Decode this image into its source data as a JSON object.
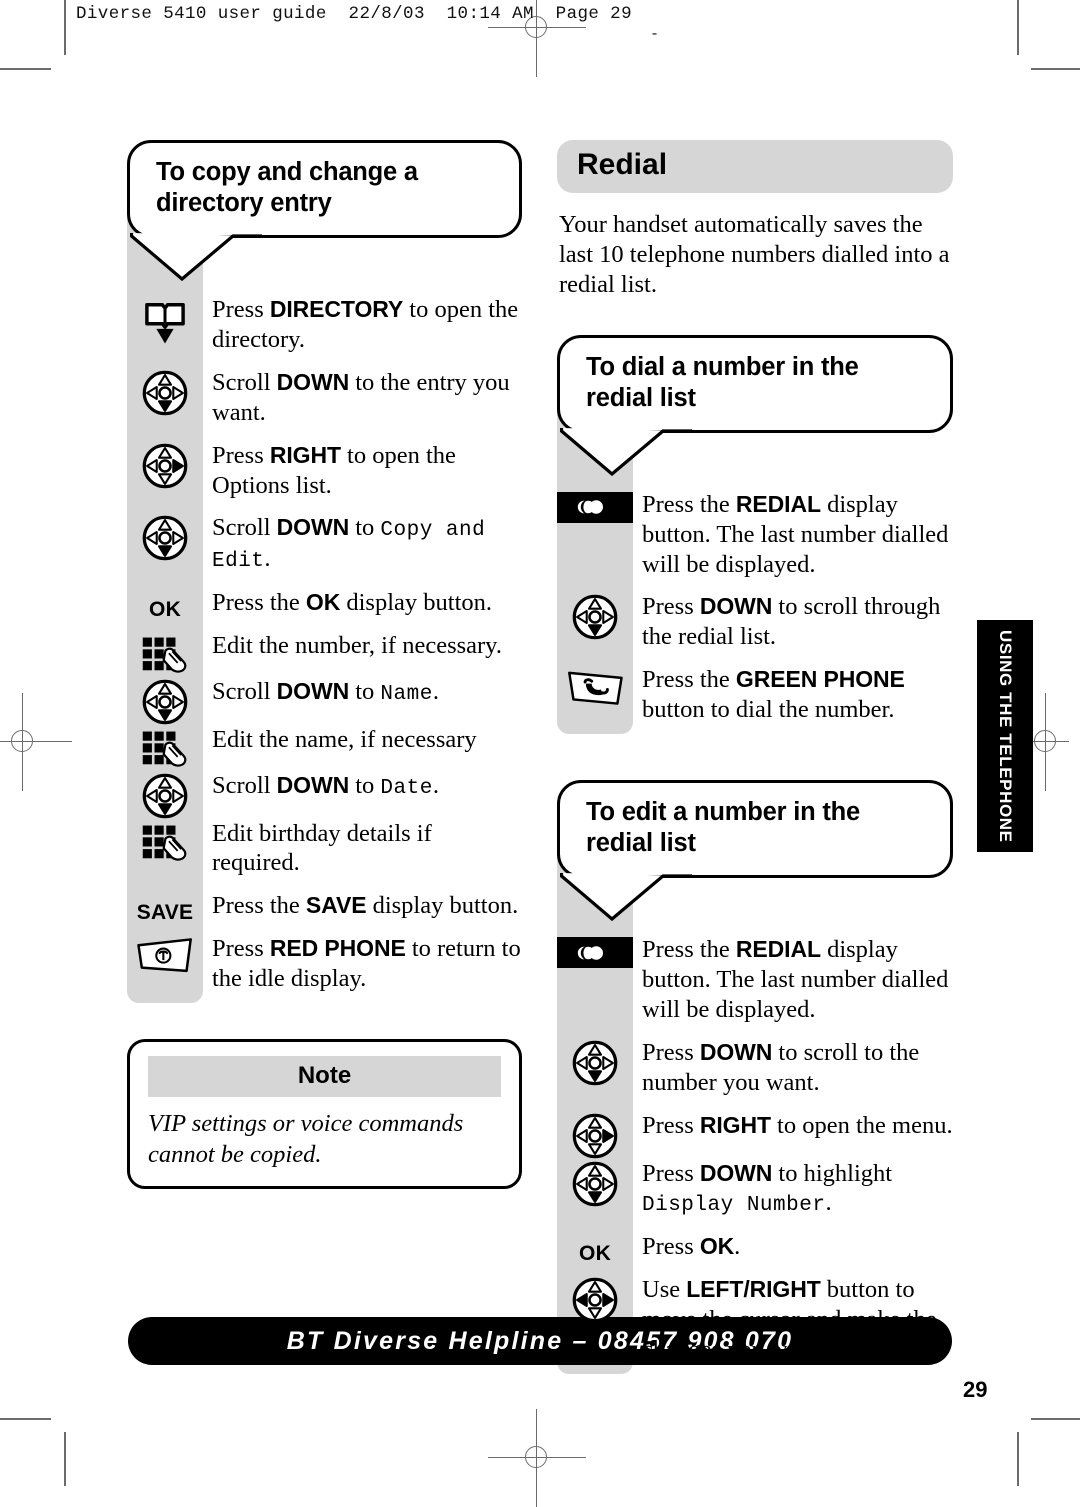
{
  "printer_slug": "Diverse 5410 user guide  22/8/03  10:14 AM  Page 29",
  "slug_dash": "-",
  "left_column": {
    "callout": {
      "title_line1": "To copy and change a",
      "title_line2": "directory entry"
    },
    "steps": [
      {
        "icon": "directory-book-icon",
        "icon_label": "",
        "text_html": "Press <b>DIRECTORY</b> to open the directory."
      },
      {
        "icon": "navpad-down-icon",
        "icon_label": "",
        "text_html": "Scroll <b>DOWN</b> to the entry you want."
      },
      {
        "icon": "navpad-right-icon",
        "icon_label": "",
        "text_html": "Press <b>RIGHT</b> to open the Options list."
      },
      {
        "icon": "navpad-down-icon",
        "icon_label": "",
        "text_html": "Scroll <b>DOWN</b> to <span class=\"lcd\">Copy and Edit</span>."
      },
      {
        "icon": "display-button-label",
        "icon_label": "OK",
        "text_html": "Press the <b>OK</b> display button."
      },
      {
        "icon": "keypad-hand-icon",
        "icon_label": "",
        "text_html": "Edit the number, if necessary."
      },
      {
        "icon": "navpad-down-icon",
        "icon_label": "",
        "text_html": "Scroll <b>DOWN</b> to <span class=\"lcd\">Name</span>."
      },
      {
        "icon": "keypad-hand-icon",
        "icon_label": "",
        "text_html": "Edit the name, if necessary"
      },
      {
        "icon": "navpad-down-icon",
        "icon_label": "",
        "text_html": "Scroll <b>DOWN</b> to <span class=\"lcd\">Date</span>."
      },
      {
        "icon": "keypad-hand-icon",
        "icon_label": "",
        "text_html": "Edit birthday details if required."
      },
      {
        "icon": "display-button-label",
        "icon_label": "SAVE",
        "text_html": "Press the <b>SAVE</b> display button."
      },
      {
        "icon": "red-phone-icon",
        "icon_label": "",
        "text_html": "Press <b>RED PHONE</b> to return to the idle display."
      }
    ],
    "note": {
      "heading": "Note",
      "body": "VIP settings or voice commands cannot be copied."
    }
  },
  "right_column": {
    "section_heading": "Redial",
    "intro": "Your handset automatically saves the last 10 telephone numbers dialled into a redial list.",
    "callout_dial": {
      "title_line1": "To dial a number in the",
      "title_line2": "redial list"
    },
    "steps_dial": [
      {
        "icon": "redial-display-button-icon",
        "icon_label": "",
        "text_html": "Press the <b>REDIAL</b> display button. The last number dialled will be displayed."
      },
      {
        "icon": "navpad-down-icon",
        "icon_label": "",
        "text_html": "Press <b>DOWN</b> to scroll through the redial list."
      },
      {
        "icon": "green-phone-icon",
        "icon_label": "",
        "text_html": "Press the <b>GREEN PHONE</b> button to dial the number."
      }
    ],
    "callout_edit": {
      "title_line1": "To edit a number in the",
      "title_line2": "redial list"
    },
    "steps_edit": [
      {
        "icon": "redial-display-button-icon",
        "icon_label": "",
        "text_html": "Press the <b>REDIAL</b> display button. The last number dialled will be displayed."
      },
      {
        "icon": "navpad-down-icon",
        "icon_label": "",
        "text_html": "Press <b>DOWN</b> to scroll to the number you want."
      },
      {
        "icon": "navpad-right-icon",
        "icon_label": "",
        "text_html": "Press <b>RIGHT</b> to open the menu."
      },
      {
        "icon": "navpad-down-icon",
        "icon_label": "",
        "text_html": "Press <b>DOWN</b> to highlight <span class=\"lcd\">Display Number</span>."
      },
      {
        "icon": "display-button-label",
        "icon_label": "OK",
        "text_html": "Press <b>OK</b>."
      },
      {
        "icon": "navpad-leftright-icon",
        "icon_label": "",
        "text_html": "Use <b>LEFT/RIGHT</b> button to move the cursor and make the changes you want."
      }
    ]
  },
  "side_tab": "USING THE TELEPHONE",
  "footer": {
    "helpline": "BT Diverse Helpline – 08457 908 070",
    "page_number": "29"
  },
  "colors": {
    "strip_gray": "#d6d6d6",
    "heading_gray": "#d6d6d6",
    "black": "#000000",
    "mark_gray": "#6b6b6b"
  }
}
